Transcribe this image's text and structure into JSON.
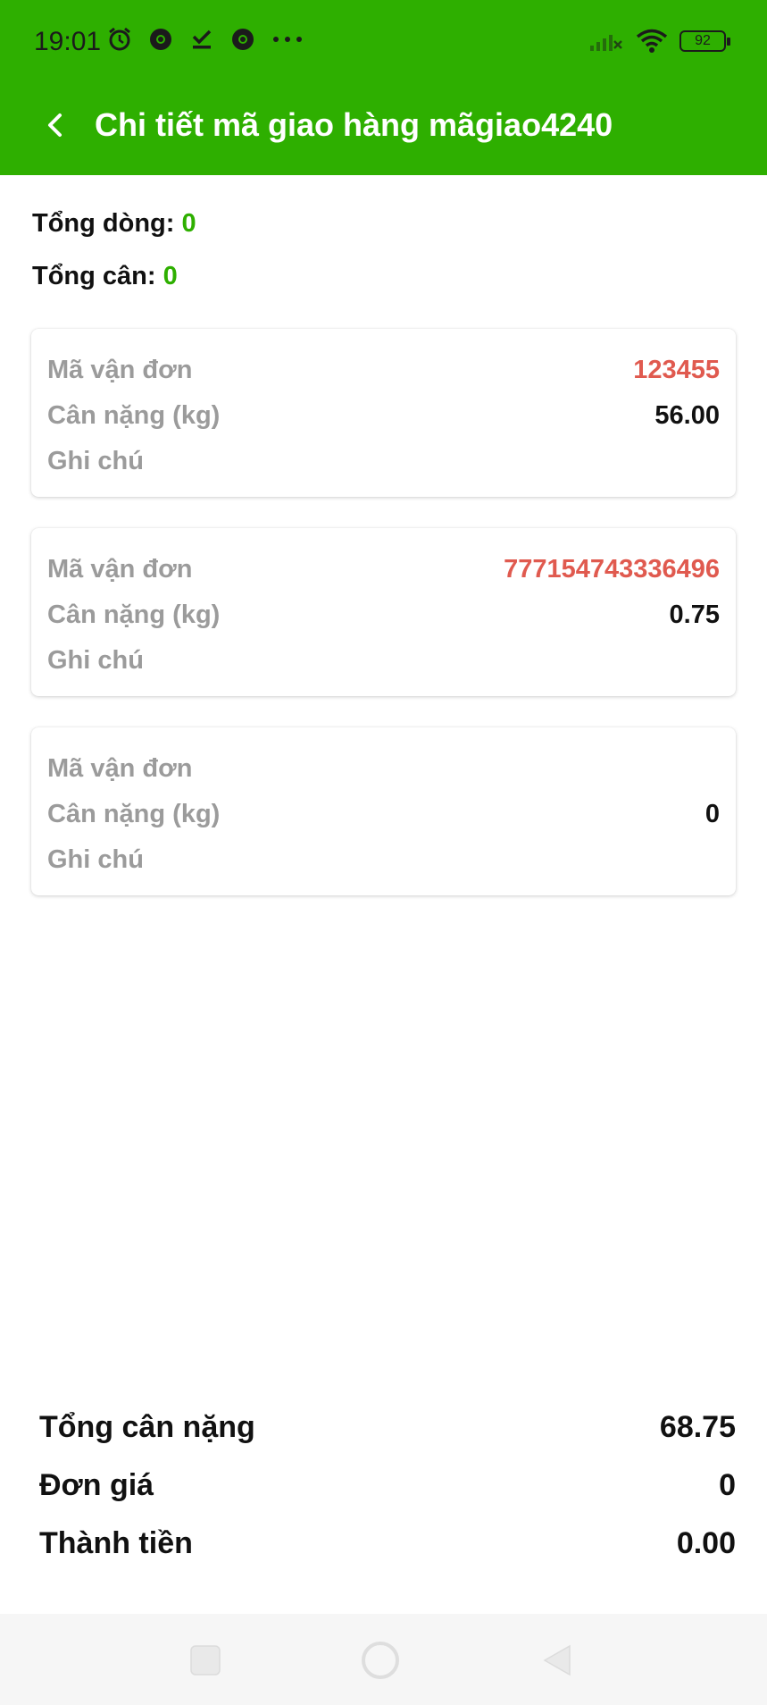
{
  "status": {
    "time": "19:01",
    "battery": "92"
  },
  "header": {
    "title": "Chi tiết mã giao hàng mãgiao4240"
  },
  "summary": {
    "total_rows_label": "Tổng dòng:",
    "total_rows_value": "0",
    "total_weight_label": "Tổng cân:",
    "total_weight_value": "0"
  },
  "cards": [
    {
      "code_label": "Mã vận đơn",
      "code": "123455",
      "weight_label": "Cân nặng (kg)",
      "weight": "56.00",
      "note_label": "Ghi chú",
      "note": ""
    },
    {
      "code_label": "Mã vận đơn",
      "code": "777154743336496",
      "weight_label": "Cân nặng (kg)",
      "weight": "0.75",
      "note_label": "Ghi chú",
      "note": ""
    },
    {
      "code_label": "Mã vận đơn",
      "code": "",
      "weight_label": "Cân nặng (kg)",
      "weight": "0",
      "note_label": "Ghi chú",
      "note": ""
    }
  ],
  "totals": {
    "total_weight_label": "Tổng cân nặng",
    "total_weight_value": "68.75",
    "unit_price_label": "Đơn giá",
    "unit_price_value": "0",
    "amount_label": "Thành tiền",
    "amount_value": "0.00"
  },
  "icons": {
    "back": "back-arrow-icon",
    "alarm": "alarm-icon",
    "chrome": "chrome-icon",
    "download": "download-done-icon",
    "more": "more-dots-icon",
    "signal": "signal-icon",
    "wifi": "wifi-icon",
    "battery": "battery-icon"
  },
  "colors": {
    "brand_green": "#2eaf00",
    "code_red": "#e05a4f",
    "label_gray": "#9b9b9b"
  }
}
